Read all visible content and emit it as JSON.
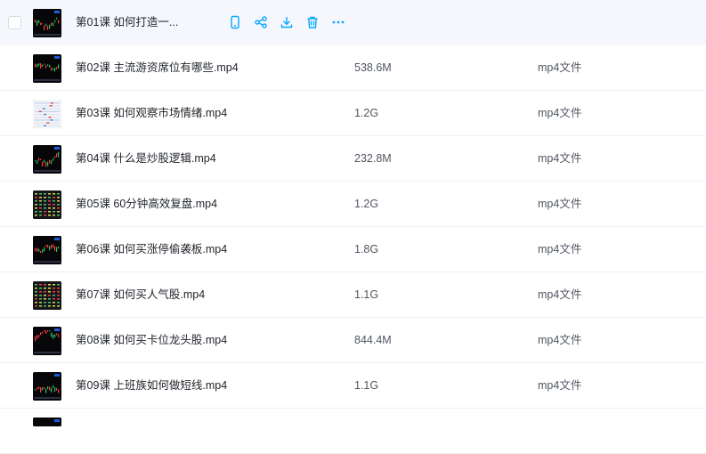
{
  "files": [
    {
      "name": "第01课 如何打造一...",
      "size": "",
      "type": "",
      "hovered": true,
      "thumb": "dark-chart"
    },
    {
      "name": "第02课 主流游资席位有哪些.mp4",
      "size": "538.6M",
      "type": "mp4文件",
      "thumb": "dark-chart"
    },
    {
      "name": "第03课 如何观察市场情绪.mp4",
      "size": "1.2G",
      "type": "mp4文件",
      "thumb": "light-table"
    },
    {
      "name": "第04课 什么是炒股逻辑.mp4",
      "size": "232.8M",
      "type": "mp4文件",
      "thumb": "dark-chart"
    },
    {
      "name": "第05课 60分钟高效复盘.mp4",
      "size": "1.2G",
      "type": "mp4文件",
      "thumb": "dark-grid"
    },
    {
      "name": "第06课 如何买涨停偷袭板.mp4",
      "size": "1.8G",
      "type": "mp4文件",
      "thumb": "dark-chart"
    },
    {
      "name": "第07课 如何买人气股.mp4",
      "size": "1.1G",
      "type": "mp4文件",
      "thumb": "dark-grid"
    },
    {
      "name": "第08课 如何买卡位龙头股.mp4",
      "size": "844.4M",
      "type": "mp4文件",
      "thumb": "dark-chart"
    },
    {
      "name": "第09课 上班族如何做短线.mp4",
      "size": "1.1G",
      "type": "mp4文件",
      "thumb": "dark-chart"
    },
    {
      "name": "",
      "size": "",
      "type": "",
      "thumb": "dark-chart"
    }
  ],
  "row_actions": [
    {
      "icon": "phone-icon",
      "name": "send-to-phone-button"
    },
    {
      "icon": "share-icon",
      "name": "share-button"
    },
    {
      "icon": "download-icon",
      "name": "download-button"
    },
    {
      "icon": "trash-icon",
      "name": "delete-button"
    },
    {
      "icon": "more-icon",
      "name": "more-button"
    }
  ],
  "colors": {
    "accent": "#06a7ff",
    "row_hover": "#f5f7fc",
    "divider": "#eef0f4"
  }
}
